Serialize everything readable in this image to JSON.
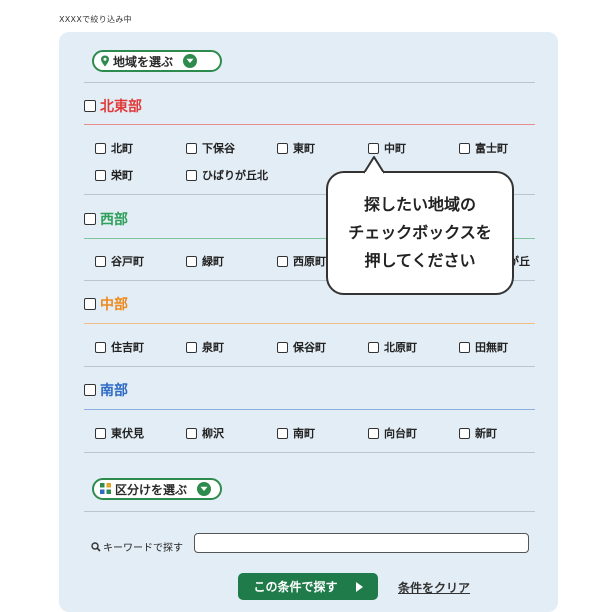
{
  "status_text": "XXXXで絞り込み中",
  "area_select": {
    "label": "地域を選ぶ",
    "icon": "map-pin-icon"
  },
  "regions": [
    {
      "name": "北東部",
      "color": "#e03a3a",
      "towns": [
        "北町",
        "下保谷",
        "東町",
        "中町",
        "富士町",
        "栄町",
        "ひばりが丘北"
      ]
    },
    {
      "name": "西部",
      "color": "#2ea05a",
      "towns": [
        "谷戸町",
        "緑町",
        "西原町",
        "",
        "ひばりが丘"
      ]
    },
    {
      "name": "中部",
      "color": "#ee8a1e",
      "towns": [
        "住吉町",
        "泉町",
        "保谷町",
        "北原町",
        "田無町"
      ]
    },
    {
      "name": "南部",
      "color": "#2f6bc4",
      "towns": [
        "東伏見",
        "柳沢",
        "南町",
        "向台町",
        "新町"
      ]
    }
  ],
  "callout": {
    "lines": [
      "探したい地域の",
      "チェックボックスを",
      "押してください"
    ]
  },
  "category_select": {
    "label": "区分けを選ぶ",
    "icon": "grid-icon"
  },
  "keyword": {
    "label": "キーワードで探す",
    "value": "",
    "placeholder": ""
  },
  "submit_label": "この条件で探す",
  "clear_label": "条件をクリア",
  "colors": {
    "accent_green": "#2e8b4e",
    "button_green": "#1f7c4a",
    "panel_bg": "#e3edf5"
  }
}
